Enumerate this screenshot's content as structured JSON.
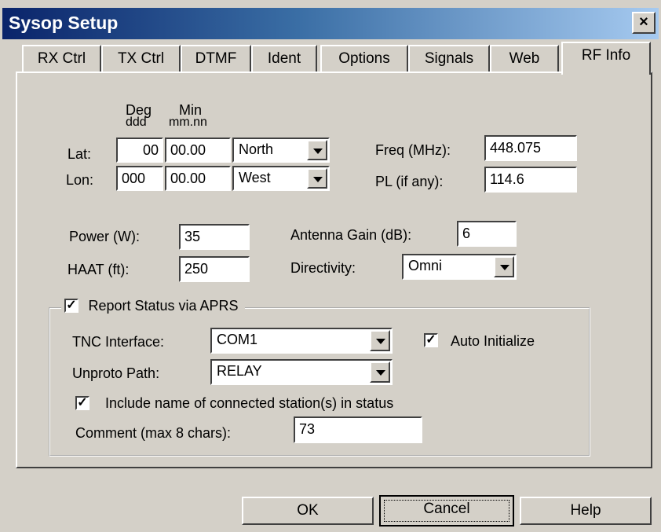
{
  "window": {
    "title": "Sysop Setup",
    "close_glyph": "×"
  },
  "tabs": [
    {
      "label": "RX Ctrl"
    },
    {
      "label": "TX Ctrl"
    },
    {
      "label": "DTMF"
    },
    {
      "label": "Ident"
    },
    {
      "label": "Options"
    },
    {
      "label": "Signals"
    },
    {
      "label": "Web"
    },
    {
      "label": "RF Info"
    }
  ],
  "active_tab": "RF Info",
  "coords": {
    "deg_header": "Deg",
    "deg_sub": "ddd",
    "min_header": "Min",
    "min_sub": "mm.nn",
    "lat_label": "Lat:",
    "lat_deg": "00",
    "lat_min": "00.00",
    "lat_dir": "North",
    "lon_label": "Lon:",
    "lon_deg": "000",
    "lon_min": "00.00",
    "lon_dir": "West"
  },
  "freq": {
    "label": "Freq (MHz):",
    "value": "448.075"
  },
  "pl": {
    "label": "PL (if any):",
    "value": "114.6"
  },
  "power": {
    "label": "Power (W):",
    "value": "35"
  },
  "haat": {
    "label": "HAAT (ft):",
    "value": "250"
  },
  "antenna_gain": {
    "label": "Antenna Gain (dB):",
    "value": "6"
  },
  "directivity": {
    "label": "Directivity:",
    "value": "Omni"
  },
  "aprs": {
    "report_label": "Report Status via APRS",
    "report_checked": true,
    "tnc_label": "TNC Interface:",
    "tnc_value": "COM1",
    "auto_init_label": "Auto Initialize",
    "auto_init_checked": true,
    "unproto_label": "Unproto Path:",
    "unproto_value": "RELAY",
    "include_label": "Include name of connected station(s) in status",
    "include_checked": true,
    "comment_label": "Comment (max 8 chars):",
    "comment_value": "73"
  },
  "checkmark": "✓",
  "buttons": {
    "ok": "OK",
    "cancel": "Cancel",
    "help": "Help"
  }
}
